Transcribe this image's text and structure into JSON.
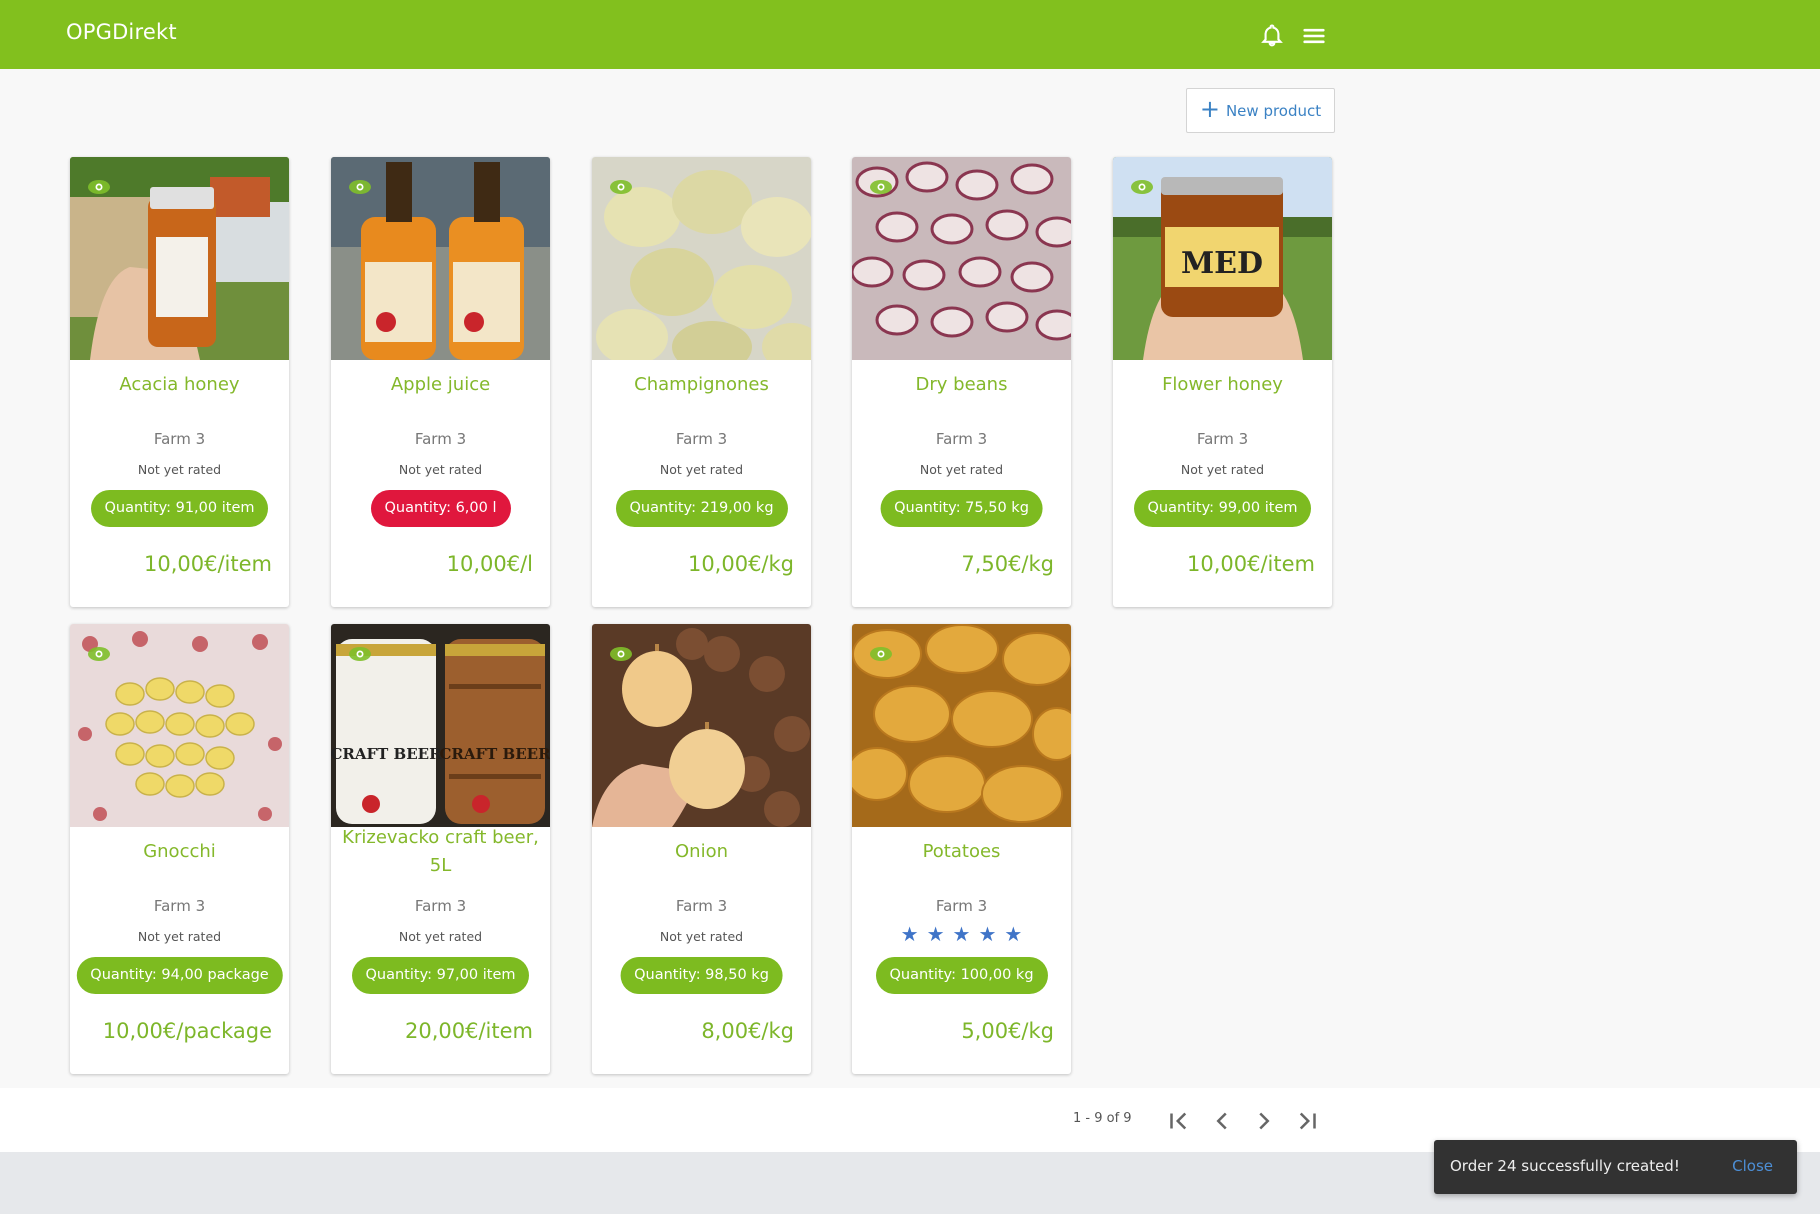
{
  "app": {
    "title": "OPGDirekt"
  },
  "header": {
    "bell_icon": "bell-icon",
    "menu_icon": "hamburger-menu-icon"
  },
  "toolbar": {
    "new_product_label": "New product",
    "new_product_icon": "plus-icon"
  },
  "colors": {
    "brand": "#82c01e",
    "price": "#7db62a",
    "quantity_ok": "#7dbb20",
    "quantity_low": "#e0173d",
    "stars": "#3f74c8"
  },
  "products": [
    {
      "name": "Acacia honey",
      "farm": "Farm 3",
      "rating": "Not yet rated",
      "quantity": "Quantity: 91,00 item",
      "price": "10,00€/item",
      "image": "honey-jar-photo"
    },
    {
      "name": "Apple juice",
      "farm": "Farm 3",
      "rating": "Not yet rated",
      "quantity": "Quantity: 6,00 l",
      "price": "10,00€/l",
      "image": "juice-bottles-photo",
      "low_stock": true
    },
    {
      "name": "Champignones",
      "farm": "Farm 3",
      "rating": "Not yet rated",
      "quantity": "Quantity: 219,00 kg",
      "price": "10,00€/kg",
      "image": "mushrooms-photo"
    },
    {
      "name": "Dry beans",
      "farm": "Farm 3",
      "rating": "Not yet rated",
      "quantity": "Quantity: 75,50 kg",
      "price": "7,50€/kg",
      "image": "beans-photo"
    },
    {
      "name": "Flower honey",
      "farm": "Farm 3",
      "rating": "Not yet rated",
      "quantity": "Quantity: 99,00 item",
      "price": "10,00€/item",
      "image": "honey-jar-photo"
    },
    {
      "name": "Gnocchi",
      "farm": "Farm 3",
      "rating": "Not yet rated",
      "quantity": "Quantity: 94,00 package",
      "price": "10,00€/package",
      "image": "gnocchi-photo"
    },
    {
      "name": "Krizevacko craft beer, 5L",
      "farm": "Farm 3",
      "rating": "Not yet rated",
      "quantity": "Quantity: 97,00 item",
      "price": "20,00€/item",
      "image": "beer-kegs-photo"
    },
    {
      "name": "Onion",
      "farm": "Farm 3",
      "rating": "Not yet rated",
      "quantity": "Quantity: 98,50 kg",
      "price": "8,00€/kg",
      "image": "onions-photo"
    },
    {
      "name": "Potatoes",
      "farm": "Farm 3",
      "stars": 5,
      "quantity": "Quantity: 100,00 kg",
      "price": "5,00€/kg",
      "image": "potatoes-photo"
    }
  ],
  "pagination": {
    "range": "1 - 9 of 9"
  },
  "toast": {
    "message": "Order 24 successfully created!",
    "close_label": "Close"
  }
}
